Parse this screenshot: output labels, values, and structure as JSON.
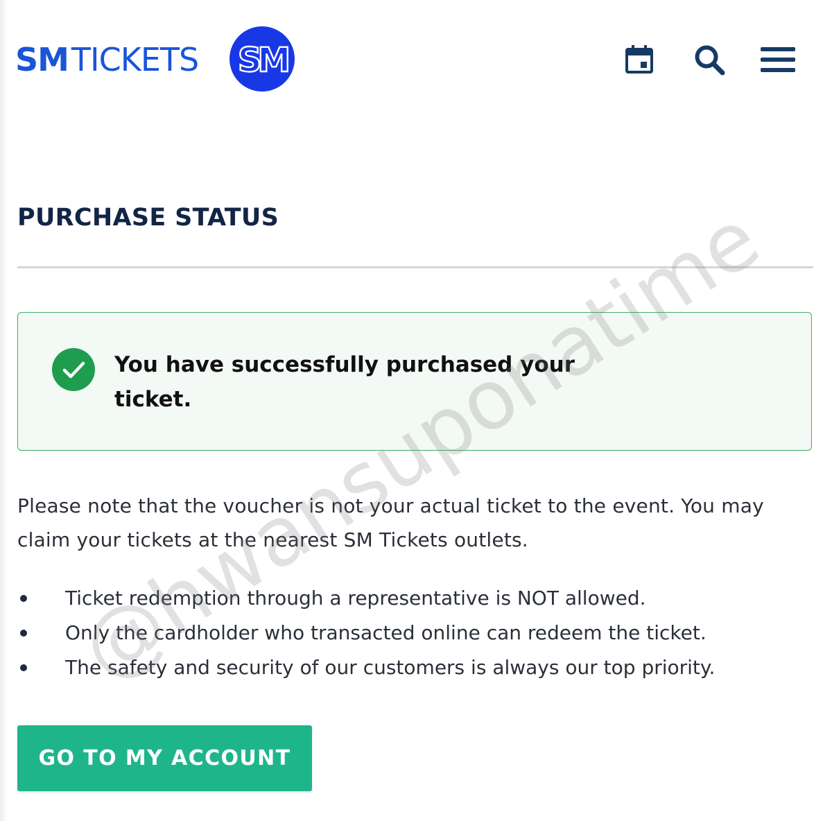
{
  "header": {
    "brand_bold": "SM",
    "brand_light": "TICKETS",
    "logo_text": "SM",
    "icons": [
      "calendar-icon",
      "search-icon",
      "menu-icon"
    ]
  },
  "page": {
    "title": "PURCHASE STATUS"
  },
  "alert": {
    "message": "You have successfully purchased your ticket.",
    "status": "success"
  },
  "note": "Please note that the voucher is not your actual ticket to the event. You may claim your tickets at the nearest SM Tickets outlets.",
  "bullets": [
    "Ticket redemption through a representative is NOT allowed.",
    "Only the cardholder who transacted online can redeem the ticket.",
    "The safety and security of our customers is always our top priority."
  ],
  "cta": {
    "label": "GO TO MY ACCOUNT"
  },
  "watermark": "@hwansuponatime",
  "colors": {
    "brand_blue": "#1a55d8",
    "logo_blue": "#1838e6",
    "nav_icon": "#163a66",
    "title": "#132546",
    "success_border": "#3fab6a",
    "success_bg": "#f3f9f5",
    "success_check": "#1f9d4e",
    "button": "#1fb58b"
  }
}
